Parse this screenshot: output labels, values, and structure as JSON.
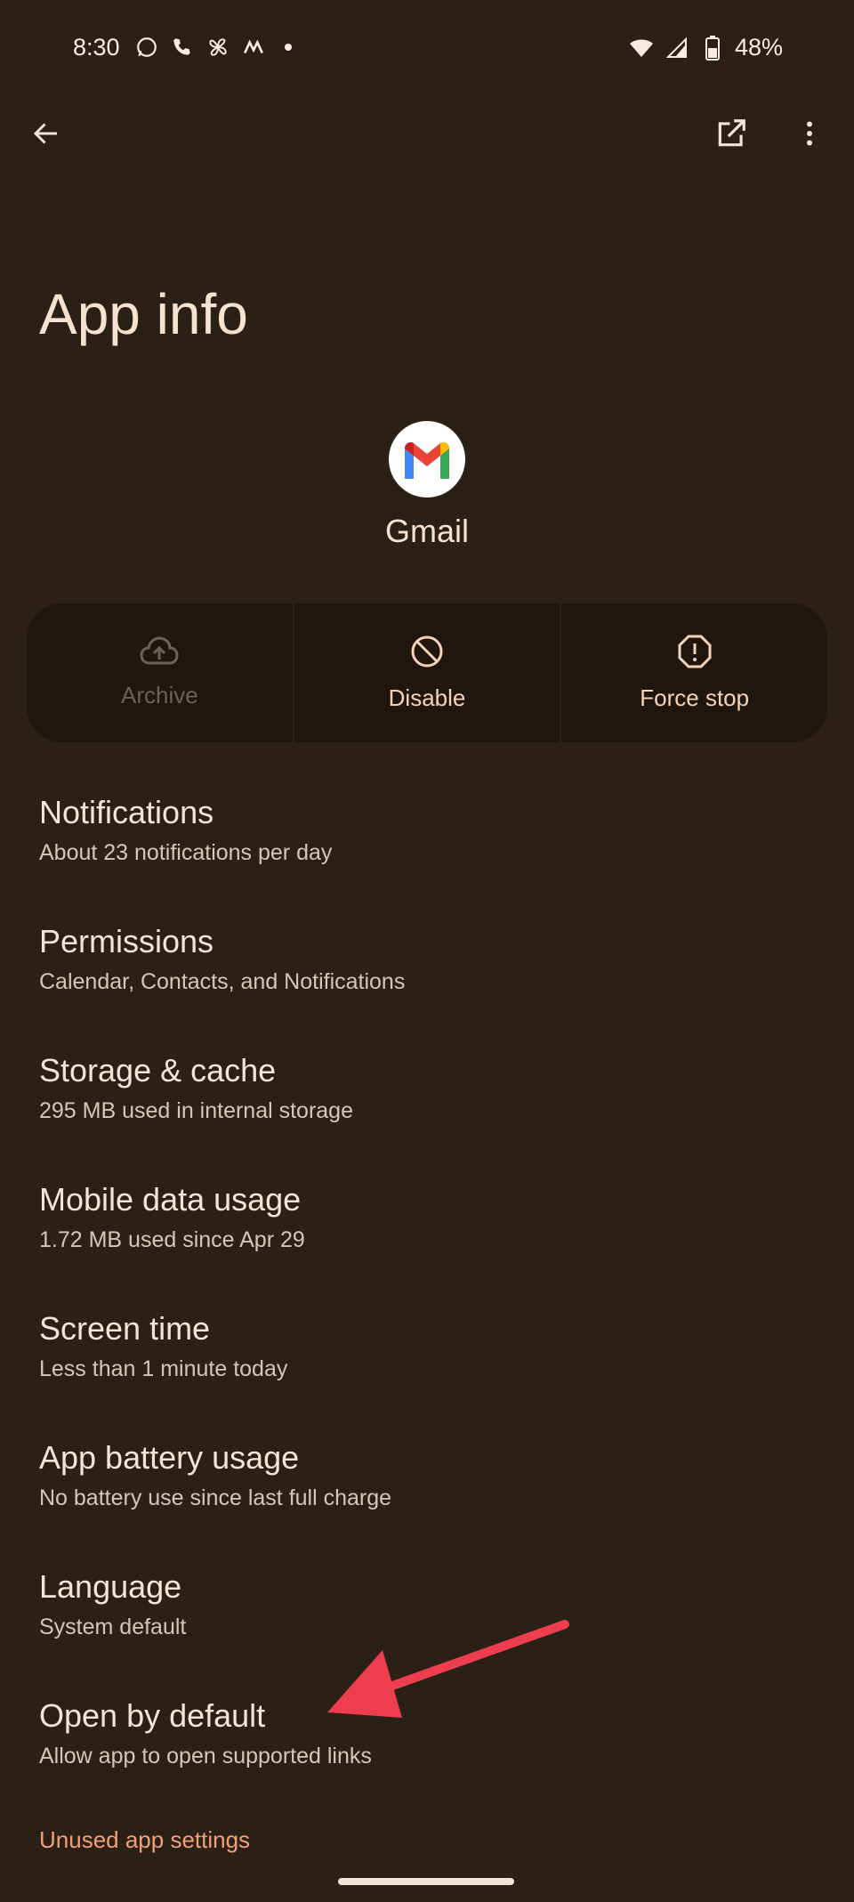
{
  "status_bar": {
    "time": "8:30",
    "battery_text": "48%",
    "left_icons": [
      "whatsapp-icon",
      "call-icon",
      "pinwheel-icon",
      "m-app-icon"
    ],
    "right_icons": [
      "wifi-icon",
      "cellular-signal-icon",
      "battery-icon"
    ]
  },
  "top_bar": {
    "back_icon": "back-arrow-icon",
    "open_icon": "open-in-new-icon",
    "more_icon": "more-vert-icon"
  },
  "page": {
    "title": "App info"
  },
  "app": {
    "name": "Gmail",
    "icon": "gmail-logo"
  },
  "actions": [
    {
      "label": "Archive",
      "icon": "cloud-upload-icon",
      "enabled": false
    },
    {
      "label": "Disable",
      "icon": "block-icon",
      "enabled": true
    },
    {
      "label": "Force stop",
      "icon": "alert-octagon-icon",
      "enabled": true
    }
  ],
  "settings": [
    {
      "title": "Notifications",
      "subtitle": "About 23 notifications per day"
    },
    {
      "title": "Permissions",
      "subtitle": "Calendar, Contacts, and Notifications"
    },
    {
      "title": "Storage & cache",
      "subtitle": "295 MB used in internal storage"
    },
    {
      "title": "Mobile data usage",
      "subtitle": "1.72 MB used since Apr 29"
    },
    {
      "title": "Screen time",
      "subtitle": "Less than 1 minute today"
    },
    {
      "title": "App battery usage",
      "subtitle": "No battery use since last full charge"
    },
    {
      "title": "Language",
      "subtitle": "System default"
    },
    {
      "title": "Open by default",
      "subtitle": "Allow app to open supported links"
    }
  ],
  "section_link": "Unused app settings",
  "colors": {
    "background": "#2a2016",
    "action_bar": "#1f170f",
    "accent": "#f2a078",
    "annotation_arrow": "#ee3d4e"
  }
}
